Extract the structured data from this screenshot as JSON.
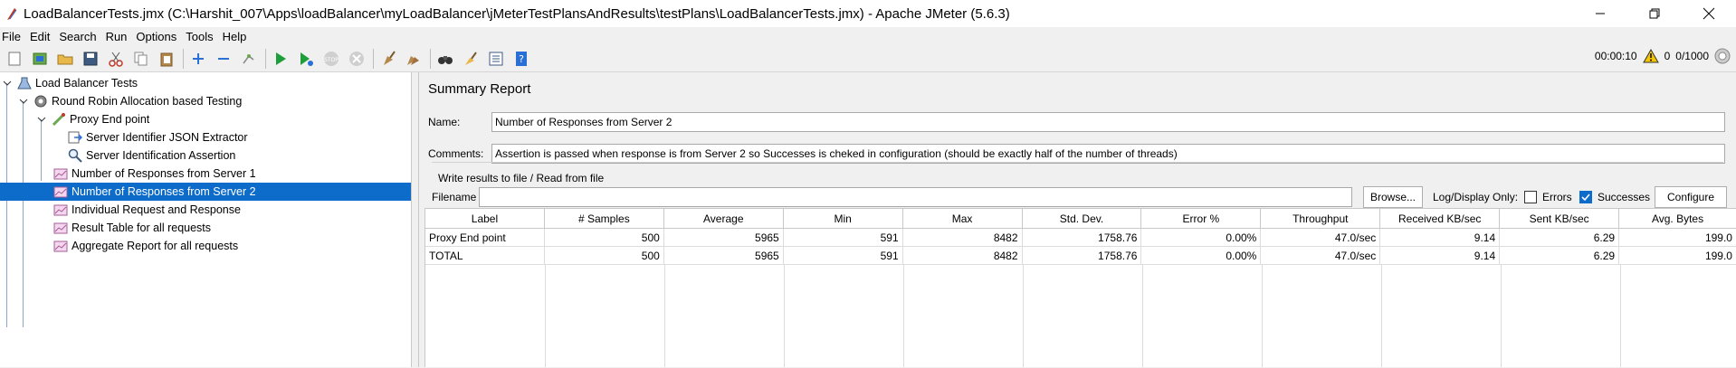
{
  "window": {
    "title": "LoadBalancerTests.jmx (C:\\Harshit_007\\Apps\\loadBalancer\\myLoadBalancer\\jMeterTestPlansAndResults\\testPlans\\LoadBalancerTests.jmx) - Apache JMeter (5.6.3)"
  },
  "menu": [
    {
      "label": "File"
    },
    {
      "label": "Edit"
    },
    {
      "label": "Search"
    },
    {
      "label": "Run"
    },
    {
      "label": "Options"
    },
    {
      "label": "Tools"
    },
    {
      "label": "Help"
    }
  ],
  "status": {
    "elapsed": "00:00:10",
    "warnings": "0",
    "threads": "0/1000"
  },
  "tree": {
    "nodes": [
      {
        "label": "Load Balancer Tests"
      },
      {
        "label": "Round Robin Allocation based Testing"
      },
      {
        "label": "Proxy End point"
      },
      {
        "label": "Server Identifier JSON Extractor"
      },
      {
        "label": "Server Identification Assertion"
      },
      {
        "label": "Number of Responses from Server 1"
      },
      {
        "label": "Number of Responses from Server 2"
      },
      {
        "label": "Individual Request and Response"
      },
      {
        "label": "Result Table for all requests"
      },
      {
        "label": "Aggregate Report for all requests"
      }
    ]
  },
  "report": {
    "title": "Summary Report",
    "name_label": "Name:",
    "name_value": "Number of Responses from Server 2",
    "comments_label": "Comments:",
    "comments_value": "Assertion is passed when response is from Server 2 so Successes is cheked in configuration (should be exactly half of the number of threads)",
    "write_group_title": "Write results to file / Read from file",
    "filename_label": "Filename",
    "filename_value": "",
    "browse_label": "Browse...",
    "log_display_label": "Log/Display Only:",
    "errors_label": "Errors",
    "errors_checked": false,
    "successes_label": "Successes",
    "successes_checked": true,
    "configure_label": "Configure"
  },
  "table": {
    "columns": [
      "Label",
      "# Samples",
      "Average",
      "Min",
      "Max",
      "Std. Dev.",
      "Error %",
      "Throughput",
      "Received KB/sec",
      "Sent KB/sec",
      "Avg. Bytes"
    ],
    "rows": [
      [
        "Proxy End point",
        "500",
        "5965",
        "591",
        "8482",
        "1758.76",
        "0.00%",
        "47.0/sec",
        "9.14",
        "6.29",
        "199.0"
      ],
      [
        "TOTAL",
        "500",
        "5965",
        "591",
        "8482",
        "1758.76",
        "0.00%",
        "47.0/sec",
        "9.14",
        "6.29",
        "199.0"
      ]
    ]
  },
  "colors": {
    "selection": "#0d6bc9",
    "run_green": "#1e9e3a",
    "toolbar_blue": "#2a6fd6"
  }
}
